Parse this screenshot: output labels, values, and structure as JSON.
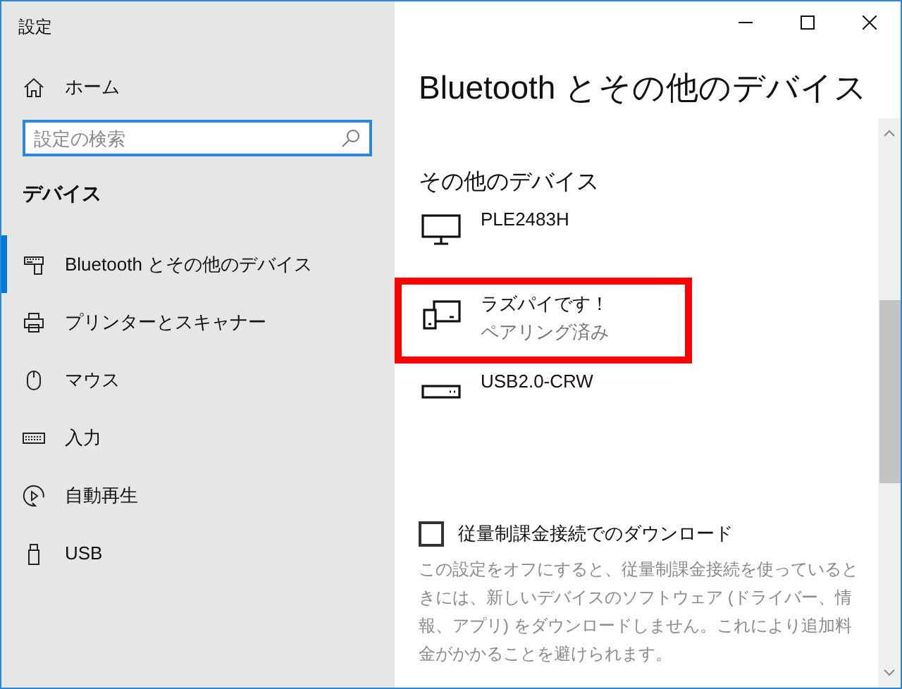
{
  "window": {
    "title": "設定"
  },
  "sidebar": {
    "home": "ホーム",
    "search": {
      "placeholder": "設定の検索"
    },
    "heading": "デバイス",
    "items": [
      {
        "label": "Bluetooth とその他のデバイス",
        "kind": "bluetooth",
        "selected": true
      },
      {
        "label": "プリンターとスキャナー",
        "kind": "printer",
        "selected": false
      },
      {
        "label": "マウス",
        "kind": "mouse",
        "selected": false
      },
      {
        "label": "入力",
        "kind": "keyboard",
        "selected": false
      },
      {
        "label": "自動再生",
        "kind": "autoplay",
        "selected": false
      },
      {
        "label": "USB",
        "kind": "usb",
        "selected": false
      }
    ]
  },
  "page": {
    "title": "Bluetooth とその他のデバイス",
    "section": "その他のデバイス",
    "devices": [
      {
        "name": "PLE2483H",
        "kind": "monitor",
        "highlighted": false
      },
      {
        "name": "ラズパイです！",
        "status": "ペアリング済み",
        "kind": "phone-pc",
        "highlighted": true
      },
      {
        "name": "USB2.0-CRW",
        "kind": "drive",
        "highlighted": false
      }
    ],
    "metered": {
      "label": "従量制課金接続でのダウンロード",
      "checked": false,
      "description": "この設定をオフにすると、従量制課金接続を使っているときには、新しいデバイスのソフトウェア (ドライバー、情報、アプリ) をダウンロードしません。これにより追加料金がかかることを避けられます。"
    }
  }
}
